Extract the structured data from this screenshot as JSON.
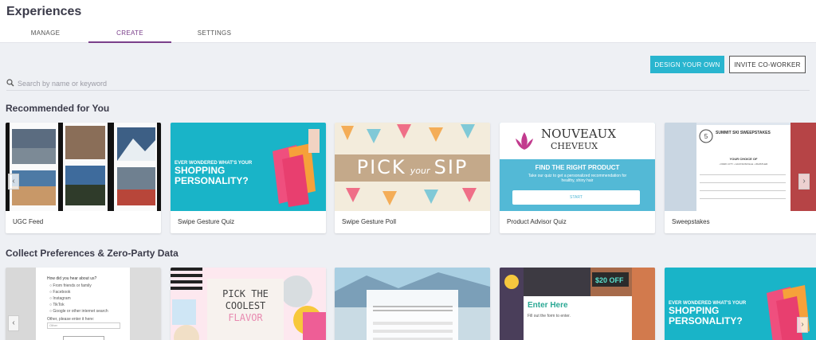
{
  "app": {
    "title": "Experiences"
  },
  "tabs": [
    {
      "label": "MANAGE"
    },
    {
      "label": "CREATE"
    },
    {
      "label": "SETTINGS"
    }
  ],
  "actions": {
    "design_own": "DESIGN YOUR OWN",
    "invite": "INVITE CO-WORKER"
  },
  "search": {
    "placeholder": "Search by name or keyword"
  },
  "sections": {
    "recommended": {
      "title": "Recommended for You",
      "cards": [
        {
          "label": "UGC Feed"
        },
        {
          "label": "Swipe Gesture Quiz",
          "thumb_text": [
            "EVER WONDERED WHAT'S YOUR",
            "SHOPPING",
            "PERSONALITY?"
          ]
        },
        {
          "label": "Swipe Gesture Poll",
          "thumb_text": [
            "PICK",
            "your",
            "SIP"
          ]
        },
        {
          "label": "Product Advisor Quiz",
          "thumb_text": [
            "NOUVEAUX",
            "CHEVEUX",
            "FIND THE RIGHT PRODUCT",
            "Take our quiz to get a personalized recommendation for healthy, shiny hair",
            "START"
          ]
        },
        {
          "label": "Sweepstakes",
          "thumb_text": [
            "SUMMIT SKI SWEEPSTAKES",
            "YOUR CHOICE OF",
            "• PARK CITY • JACKSONVILLE • WHISTLER"
          ]
        }
      ]
    },
    "preferences": {
      "title": "Collect Preferences & Zero-Party Data",
      "cards": [
        {
          "thumb_text": [
            "How did you hear about us?",
            "From friends or family",
            "Facebook",
            "Instagram",
            "TikTok",
            "Google or other internet search",
            "Other, please enter it here:",
            "Other"
          ]
        },
        {
          "thumb_text": [
            "PICK THE",
            "COOLEST",
            "FLAVOR"
          ]
        },
        {
          "thumb_text": []
        },
        {
          "thumb_text": [
            "$20 OFF",
            "Enter Here",
            "Fill out the form to enter."
          ]
        },
        {
          "thumb_text": [
            "EVER WONDERED WHAT'S YOUR",
            "SHOPPING",
            "PERSONALITY?"
          ]
        }
      ]
    }
  },
  "colors": {
    "accent": "#29b5cf",
    "tab_active": "#7a3f8a",
    "teal_card": "#19b4c8",
    "advisor_bg": "#53b9d6",
    "flavor_bg": "#fde8ef"
  },
  "icons": {
    "search": "search-icon",
    "prev": "chevron-left-icon",
    "next": "chevron-right-icon"
  }
}
